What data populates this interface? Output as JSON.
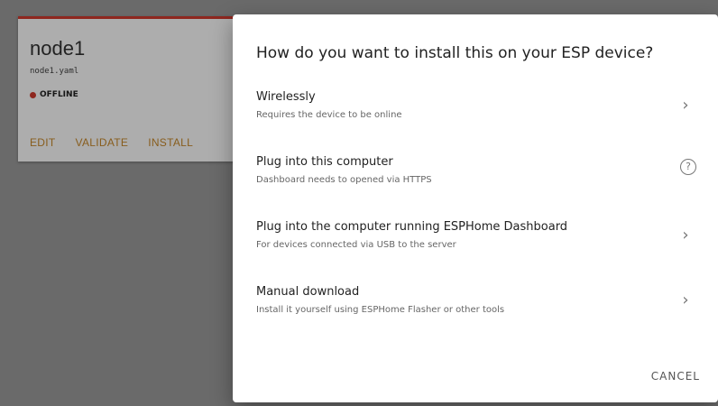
{
  "node_card": {
    "name": "node1",
    "file": "node1.yaml",
    "status": "OFFLINE",
    "actions": [
      "EDIT",
      "VALIDATE",
      "INSTALL"
    ]
  },
  "dialog": {
    "title": "How do you want to install this on your ESP device?",
    "options": [
      {
        "title": "Wirelessly",
        "description": "Requires the device to be online",
        "trail": "chevron-right-icon"
      },
      {
        "title": "Plug into this computer",
        "description": "Dashboard needs to opened via HTTPS",
        "trail": "help-icon"
      },
      {
        "title": "Plug into the computer running ESPHome Dashboard",
        "description": "For devices connected via USB to the server",
        "trail": "chevron-right-icon"
      },
      {
        "title": "Manual download",
        "description": "Install it yourself using ESPHome Flasher or other tools",
        "trail": "chevron-right-icon"
      }
    ],
    "cancel_label": "CANCEL"
  },
  "colors": {
    "accent_action": "#c98a2c",
    "status_offline": "#d23a2e"
  }
}
